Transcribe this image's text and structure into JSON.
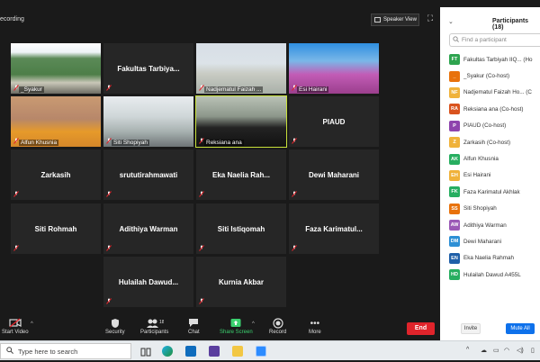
{
  "meeting": {
    "recording_label": "ecording",
    "speaker_view_label": "Speaker View"
  },
  "tiles": [
    {
      "label": "_Syakur",
      "name": "",
      "video": true,
      "speaking": false
    },
    {
      "label": "",
      "name": "Fakultas  Tarbiya...",
      "video": false,
      "speaking": false
    },
    {
      "label": "Nadjematul Faizah ...",
      "name": "",
      "video": true,
      "speaking": false
    },
    {
      "label": "Esi Hairani",
      "name": "",
      "video": true,
      "speaking": false
    },
    {
      "label": "Alfun Khusnia",
      "name": "",
      "video": true,
      "speaking": false
    },
    {
      "label": "Siti Shopiyah",
      "name": "",
      "video": true,
      "speaking": false
    },
    {
      "label": "Reksiana ana",
      "name": "",
      "video": true,
      "speaking": true
    },
    {
      "label": "",
      "name": "PIAUD",
      "video": false,
      "speaking": false
    },
    {
      "label": "",
      "name": "Zarkasih",
      "video": false,
      "speaking": false
    },
    {
      "label": "",
      "name": "srututirahmawati",
      "video": false,
      "speaking": false
    },
    {
      "label": "",
      "name": "Eka  Naelia  Rah...",
      "video": false,
      "speaking": false
    },
    {
      "label": "",
      "name": "Dewi  Maharani",
      "video": false,
      "speaking": false
    },
    {
      "label": "",
      "name": "Siti  Rohmah",
      "video": false,
      "speaking": false
    },
    {
      "label": "",
      "name": "Adithiya  Warman",
      "video": false,
      "speaking": false
    },
    {
      "label": "",
      "name": "Siti  Istiqomah",
      "video": false,
      "speaking": false
    },
    {
      "label": "",
      "name": "Faza  Karimatul...",
      "video": false,
      "speaking": false
    },
    {
      "label": "",
      "name": "Hulailah  Dawud...",
      "video": false,
      "speaking": false
    },
    {
      "label": "",
      "name": "Kurnia  Akbar",
      "video": false,
      "speaking": false
    }
  ],
  "toolbar": {
    "start_video": "Start Video",
    "security": "Security",
    "participants": "Participants",
    "participants_count": "18",
    "chat": "Chat",
    "share_screen": "Share Screen",
    "record": "Record",
    "more": "More",
    "end": "End"
  },
  "panel": {
    "title": "Participants (18)",
    "search_placeholder": "Find a participant",
    "invite": "Invite",
    "mute_all": "Mute All",
    "participants": [
      {
        "initials": "FT",
        "name": "Fakultas  Tarbiyah  IIQ...  (Ho",
        "color": "#2ea44f"
      },
      {
        "initials": "_",
        "name": "_Syakur  (Co-host)",
        "color": "#e8720c"
      },
      {
        "initials": "NF",
        "name": "Nadjematul  Faizah  Ho...  (C",
        "color": "#f0b23a"
      },
      {
        "initials": "RA",
        "name": "Reksiana  ana  (Co-host)",
        "color": "#d9531e"
      },
      {
        "initials": "P",
        "name": "PIAUD  (Co-host)",
        "color": "#8e44ad"
      },
      {
        "initials": "Z",
        "name": "Zarkasih  (Co-host)",
        "color": "#f0b23a"
      },
      {
        "initials": "AK",
        "name": "Alfun  Khusnia",
        "color": "#27ae60"
      },
      {
        "initials": "EH",
        "name": "Esi  Hairani",
        "color": "#f0b23a"
      },
      {
        "initials": "FK",
        "name": "Faza  Karimatul  Akhlak",
        "color": "#27ae60"
      },
      {
        "initials": "SS",
        "name": "Siti  Shopiyah",
        "color": "#e8720c"
      },
      {
        "initials": "AW",
        "name": "Adithiya  Warman",
        "color": "#9b59b6"
      },
      {
        "initials": "DM",
        "name": "Dewi  Maharani",
        "color": "#2d8fd5"
      },
      {
        "initials": "EN",
        "name": "Eka  Naelia  Rahmah",
        "color": "#1f5fa8"
      },
      {
        "initials": "HD",
        "name": "Hulailah  Dawud  A455L",
        "color": "#27ae60"
      }
    ]
  },
  "taskbar": {
    "search_placeholder": "Type here to search"
  }
}
